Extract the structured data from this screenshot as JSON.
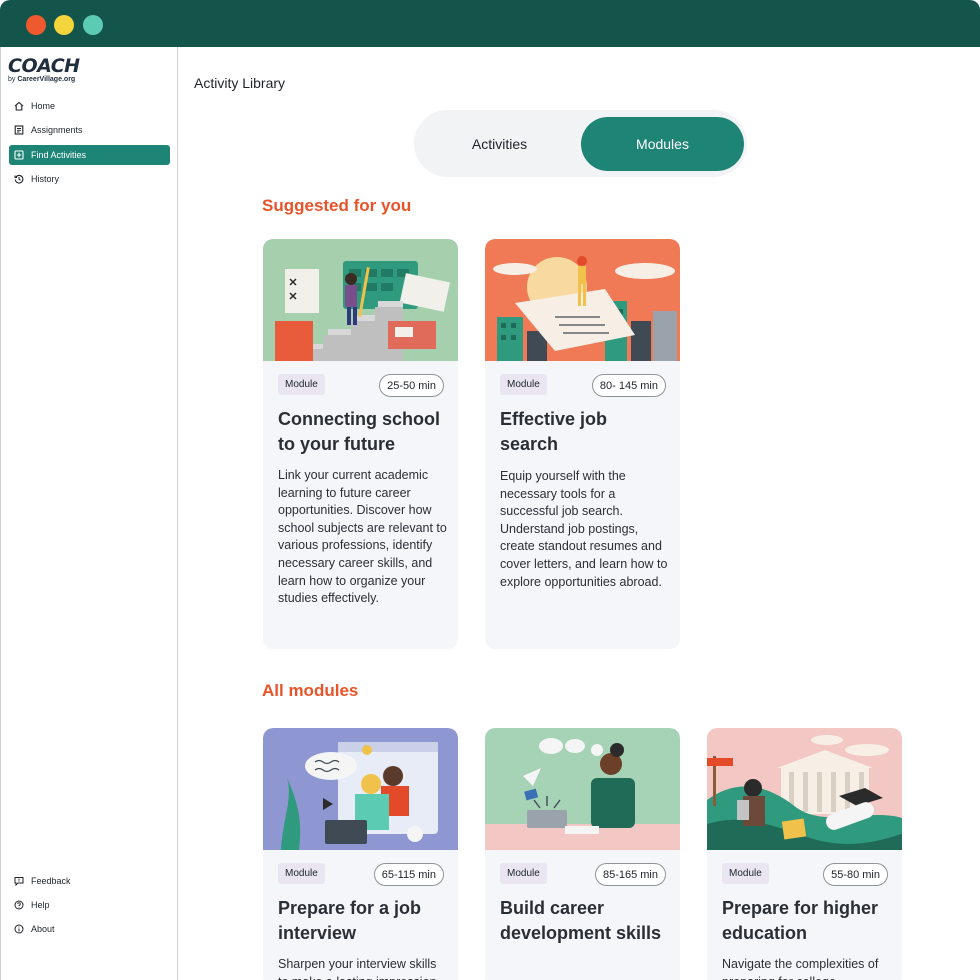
{
  "window": {
    "colors": {
      "titlebar": "#13544b",
      "accent": "#1e8576",
      "section": "#e8542a"
    }
  },
  "brand": {
    "name": "COACH",
    "by": "by",
    "org": "CareerVillage.org"
  },
  "sidebar": {
    "items": [
      {
        "label": "Home",
        "icon": "home-icon"
      },
      {
        "label": "Assignments",
        "icon": "assignments-icon"
      },
      {
        "label": "Find Activities",
        "icon": "plus-square-icon",
        "active": true
      },
      {
        "label": "History",
        "icon": "history-icon"
      }
    ],
    "bottom": [
      {
        "label": "Feedback",
        "icon": "feedback-icon"
      },
      {
        "label": "Help",
        "icon": "help-icon"
      },
      {
        "label": "About",
        "icon": "info-icon"
      }
    ]
  },
  "page": {
    "title": "Activity Library"
  },
  "toggle": {
    "activities": "Activities",
    "modules": "Modules",
    "selected": "Modules"
  },
  "sections": {
    "suggested": "Suggested for you",
    "all": "All modules"
  },
  "suggested_cards": [
    {
      "badge": "Module",
      "duration": "25-50 min",
      "title": "Connecting school to your future",
      "description": "Link your current academic learning to future career opportunities. Discover how school subjects are relevant to various professions, identify necessary career skills, and learn how to organize your studies effectively."
    },
    {
      "badge": "Module",
      "duration": "80- 145 min",
      "title": "Effective job search",
      "description": "Equip yourself with the necessary tools for a successful job search. Understand job postings, create standout resumes and cover letters, and learn how to explore opportunities abroad."
    }
  ],
  "all_cards": [
    {
      "badge": "Module",
      "duration": "65-115 min",
      "title": "Prepare for a job interview",
      "description": "Sharpen your interview skills to make a lasting impression"
    },
    {
      "badge": "Module",
      "duration": "85-165 min",
      "title": "Build career development skills",
      "description": ""
    },
    {
      "badge": "Module",
      "duration": "55-80 min",
      "title": "Prepare for higher education",
      "description": "Navigate the complexities of preparing for college"
    }
  ]
}
